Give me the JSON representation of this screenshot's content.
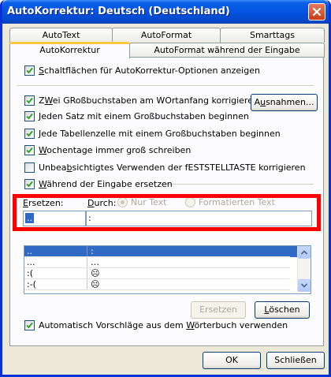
{
  "window": {
    "title": "AutoKorrektur: Deutsch (Deutschland)"
  },
  "tabs": {
    "row_back": [
      "AutoText",
      "AutoFormat",
      "Smarttags"
    ],
    "row_front": [
      "AutoKorrektur",
      "AutoFormat während der Eingabe"
    ],
    "active": "AutoKorrektur"
  },
  "options": {
    "show_buttons": {
      "pre": "",
      "key": "S",
      "post": "chaltflächen für AutoKorrektur-Optionen anzeigen",
      "checked": true
    },
    "two_caps": {
      "pre": "Z",
      "key": "W",
      "post": "ei GRoßbuchstaben am WOrtanfang korrigieren",
      "checked": true
    },
    "sentence": {
      "pre": "",
      "key": "J",
      "post": "eden Satz mit einem Großbuchstaben beginnen",
      "checked": true
    },
    "table_cell": {
      "pre": "",
      "key": "J",
      "post": "ede Tabellenzelle mit einem Großbuchstaben beginnen",
      "checked": true
    },
    "weekdays": {
      "pre": "",
      "key": "W",
      "post": "ochentage immer groß schreiben",
      "checked": true
    },
    "capslock": {
      "pre": "Unbea",
      "key": "b",
      "post": "sichtigtes Verwenden der fESTSTELLTASTE korrigieren",
      "checked": false
    },
    "replace_typing": {
      "pre": "",
      "key": "W",
      "post": "ährend der Eingabe ersetzen",
      "checked": true
    },
    "dictionary": {
      "pre": "Automatisch Vorschläge aus dem ",
      "key": "W",
      "post": "örterbuch verwenden",
      "checked": true
    }
  },
  "exceptions_button": {
    "pre": "A",
    "key": "u",
    "post": "snahmen..."
  },
  "replace": {
    "replace_label": {
      "pre": "",
      "key": "E",
      "post": "rsetzen:"
    },
    "with_label": {
      "pre": "",
      "key": "D",
      "post": "urch:"
    },
    "plain_text": "Nur Text",
    "formatted_text": "Formatierten Text",
    "replace_value": "..",
    "with_value": ":"
  },
  "entries": [
    {
      "from": "..",
      "to": ":"
    },
    {
      "from": "...",
      "to": "…"
    },
    {
      "from": ":(",
      "to": "☹"
    },
    {
      "from": ":-(",
      "to": "☹"
    }
  ],
  "buttons": {
    "replace": "Ersetzen",
    "delete": {
      "pre": "",
      "key": "L",
      "post": "öschen"
    },
    "ok": "OK",
    "close": "Schließen"
  },
  "colors": {
    "titlebar": "#0554e3",
    "dialog_bg": "#ece9d8",
    "selection": "#316ac5",
    "highlight": "#ff0000"
  }
}
